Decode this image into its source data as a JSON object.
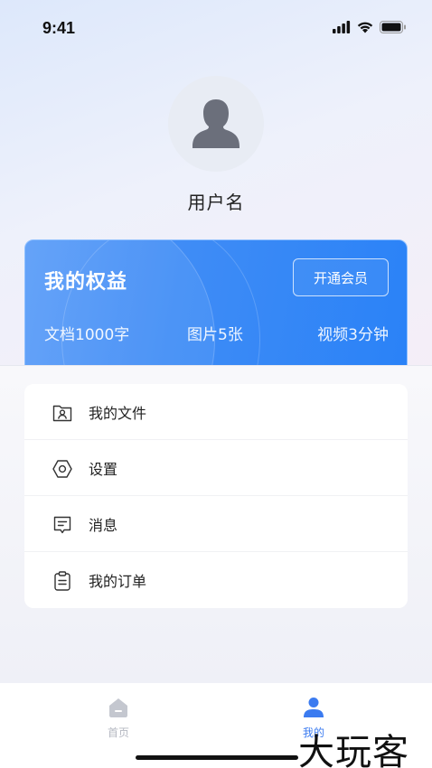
{
  "status_bar": {
    "time": "9:41"
  },
  "profile": {
    "username": "用户名"
  },
  "benefits": {
    "title": "我的权益",
    "button_label": "开通会员",
    "quotas": [
      "文档1000字",
      "图片5张",
      "视频3分钟"
    ]
  },
  "menu": {
    "items": [
      {
        "label": "我的文件",
        "icon": "file-user-icon"
      },
      {
        "label": "设置",
        "icon": "hexagon-settings-icon"
      },
      {
        "label": "消息",
        "icon": "message-icon"
      },
      {
        "label": "我的订单",
        "icon": "clipboard-order-icon"
      }
    ]
  },
  "tab_bar": {
    "tabs": [
      {
        "label": "首页",
        "active": false
      },
      {
        "label": "我的",
        "active": true
      }
    ]
  },
  "colors": {
    "accent": "#3b7bf0",
    "card_blue": "#2a82f7"
  },
  "watermark": "大玩客"
}
